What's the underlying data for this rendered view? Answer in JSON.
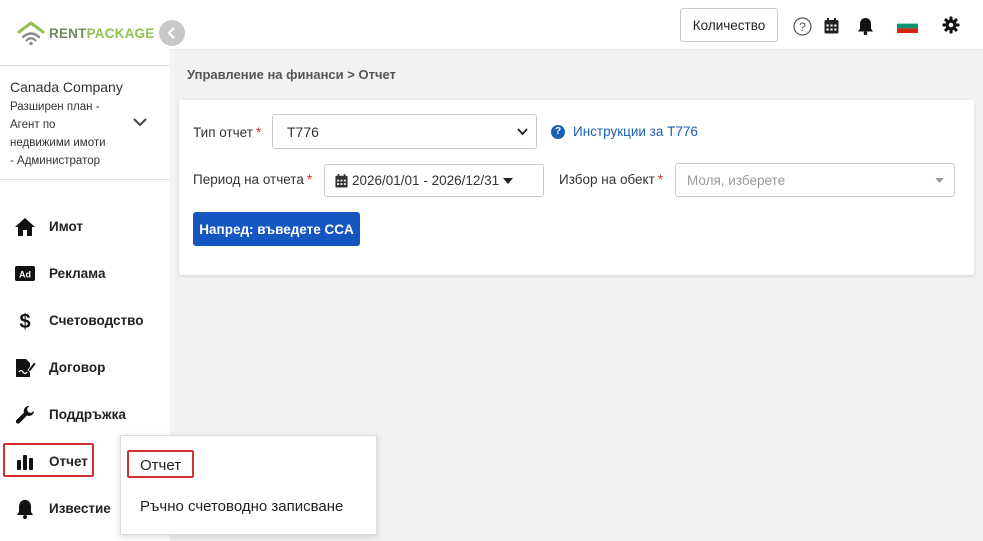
{
  "logo": {
    "part1": "RENT",
    "part2": "PACKAGE"
  },
  "company": {
    "name": "Canada Company",
    "plan_lines": [
      "Разширен план -",
      "Агент по",
      "недвижими имоти",
      "- Администратор"
    ]
  },
  "sidebar": {
    "items": [
      {
        "label": "Имот",
        "icon": "home-icon"
      },
      {
        "label": "Реклама",
        "icon": "ad-icon"
      },
      {
        "label": "Счетоводство",
        "icon": "dollar-icon"
      },
      {
        "label": "Договор",
        "icon": "contract-icon"
      },
      {
        "label": "Поддръжка",
        "icon": "wrench-icon"
      },
      {
        "label": "Отчет",
        "icon": "chart-icon"
      },
      {
        "label": "Известие",
        "icon": "bell-icon"
      }
    ]
  },
  "topbar": {
    "quantity_label": "Количество",
    "accent_flag_colors": [
      "#ffffff",
      "#00966e",
      "#d62612"
    ]
  },
  "breadcrumb": "Управление на финанси > Отчет",
  "form": {
    "report_type_label": "Тип отчет",
    "report_type_value": "T776",
    "help_link": "Инструкции за T776",
    "period_label": "Период на отчета",
    "period_value": "2026/01/01 - 2026/12/31",
    "object_label": "Избор на обект",
    "object_placeholder": "Моля, изберете",
    "required_mark": "*",
    "next_button": "Напред: въведете CCA"
  },
  "popup": {
    "items": [
      "Отчет",
      "Ръчно счетоводно записване"
    ]
  },
  "colors": {
    "primary": "#1557c0",
    "required": "#d32f2f",
    "brand_green": "#8fc24f",
    "highlight": "#d32f2f"
  }
}
